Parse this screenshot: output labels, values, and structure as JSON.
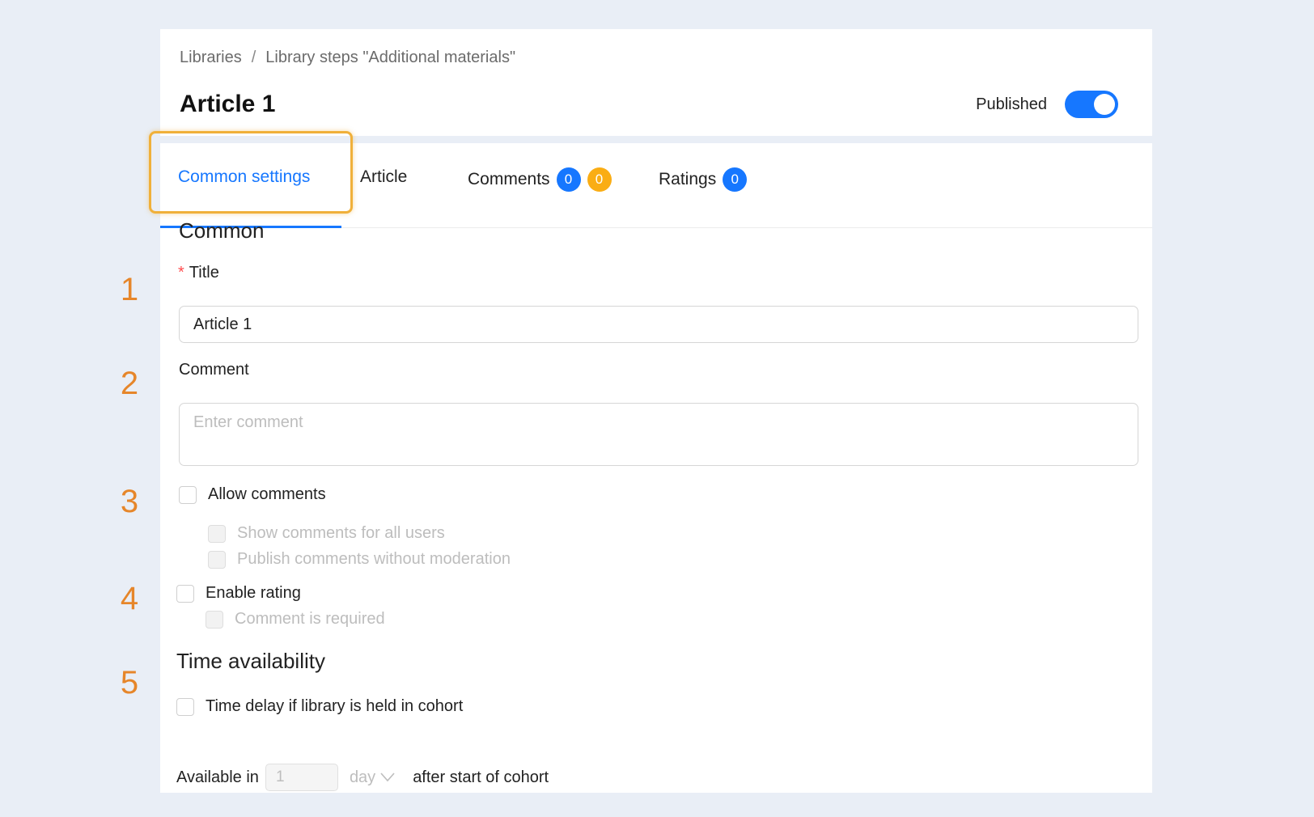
{
  "breadcrumb": {
    "items": [
      "Libraries",
      "Library steps \"Additional materials\""
    ],
    "separator": "/"
  },
  "page": {
    "title": "Article 1"
  },
  "published": {
    "label": "Published",
    "on": true
  },
  "tabs": [
    {
      "label": "Common settings",
      "active": true
    },
    {
      "label": "Article"
    },
    {
      "label": "Comments",
      "badges": [
        "0",
        "0"
      ]
    },
    {
      "label": "Ratings",
      "badges": [
        "0"
      ]
    }
  ],
  "section_common": "Common",
  "title_field": {
    "label": "Title",
    "required_mark": "*",
    "value": "Article 1"
  },
  "comment_field": {
    "label": "Comment",
    "placeholder": "Enter comment"
  },
  "allow_comments": {
    "label": "Allow comments",
    "checked": false
  },
  "show_comments_all": {
    "label": "Show comments for all users",
    "disabled": true
  },
  "publish_without_moderation": {
    "label": "Publish comments without moderation",
    "disabled": true
  },
  "enable_rating": {
    "label": "Enable rating",
    "checked": false
  },
  "comment_required": {
    "label": "Comment is required",
    "disabled": true
  },
  "section_time": "Time availability",
  "time_delay": {
    "label": "Time delay if library is held in cohort",
    "checked": false
  },
  "available": {
    "prefix": "Available in",
    "value": "1",
    "unit": "day",
    "suffix": "after start of cohort"
  },
  "markers": [
    "1",
    "2",
    "3",
    "4",
    "5"
  ],
  "colors": {
    "accent": "#1677ff",
    "badge_orange": "#faad14",
    "marker": "#e6862a",
    "highlight": "#f0b03a",
    "required": "#ff4d4f"
  }
}
